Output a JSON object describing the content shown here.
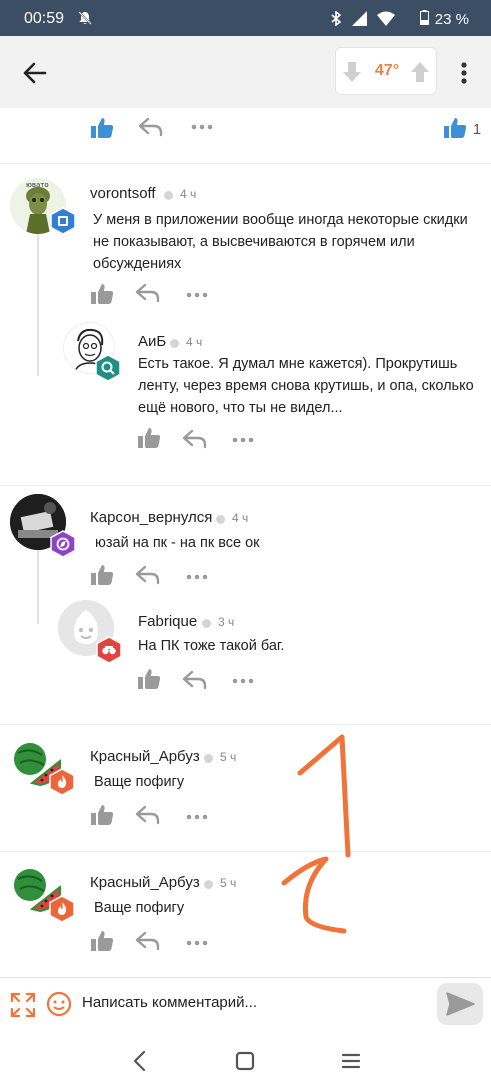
{
  "status_bar": {
    "time": "00:59",
    "battery": "23 %"
  },
  "post_header": {
    "rating": "47°",
    "rating_color": "#e6834a"
  },
  "previous_comment": {
    "like_count": "1"
  },
  "comments": [
    {
      "author": "vorontsoff",
      "time": "4 ч",
      "text": "У меня в приложении вообще иногда некоторые скидки не показывают, а высвечиваются в горячем или обсуждениях"
    },
    {
      "author": "АиБ",
      "time": "4 ч",
      "text": "Есть такое.  Я думал мне кажется). Прокрутишь ленту, через время снова крутишь, и опа, сколько ещё нового, что ты не видел..."
    },
    {
      "author": "Карсон_вернулся",
      "time": "4 ч",
      "text": "юзай на пк - на пк все ок"
    },
    {
      "author": "Fabrique",
      "time": "3 ч",
      "text": "На ПК тоже такой баг."
    },
    {
      "author": "Красный_Арбуз",
      "time": "5 ч",
      "text": "Ваще пофигу"
    },
    {
      "author": "Красный_Арбуз",
      "time": "5 ч",
      "text": "Ваще пофигу"
    }
  ],
  "annotations": [
    "1",
    "2"
  ],
  "comment_input": {
    "placeholder": "Написать комментарий..."
  }
}
